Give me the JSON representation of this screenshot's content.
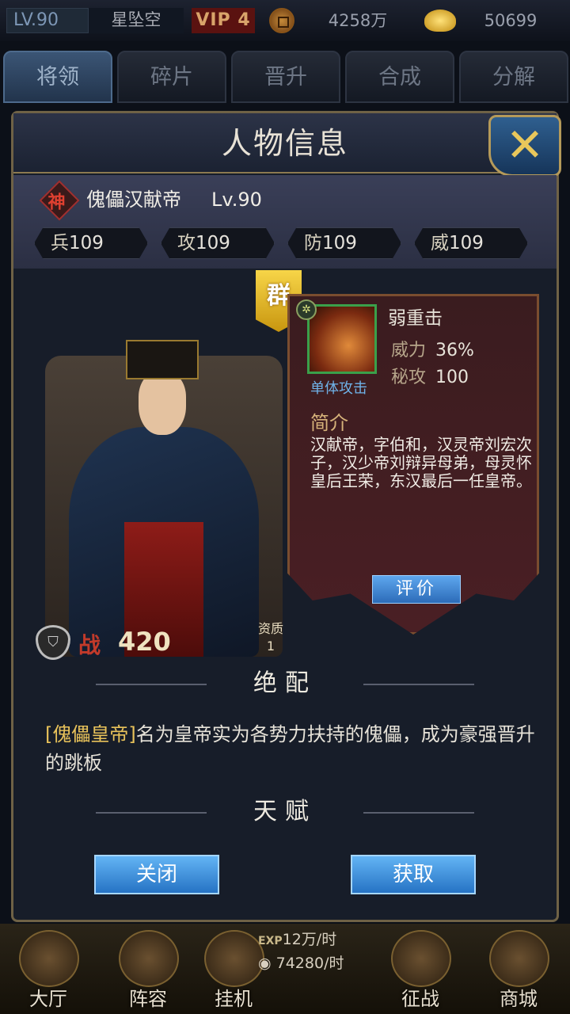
{
  "topbar": {
    "level": "LV.90",
    "player_name": "星坠空",
    "vip": "VIP 4",
    "coins": "4258万",
    "gold": "50699"
  },
  "tabs": [
    {
      "label": "将领",
      "active": true
    },
    {
      "label": "碎片",
      "active": false
    },
    {
      "label": "晋升",
      "active": false
    },
    {
      "label": "合成",
      "active": false
    },
    {
      "label": "分解",
      "active": false
    }
  ],
  "panel": {
    "title": "人物信息",
    "close_glyph": "✕"
  },
  "hero": {
    "rarity": "神",
    "name": "傀儡汉献帝",
    "level": "Lv.90",
    "faction": "群",
    "stats": [
      {
        "label": "兵",
        "value": "109"
      },
      {
        "label": "攻",
        "value": "109"
      },
      {
        "label": "防",
        "value": "109"
      },
      {
        "label": "威",
        "value": "109"
      }
    ],
    "power_label": "战",
    "power": "420",
    "quality_label": "资质",
    "quality": "1"
  },
  "skill": {
    "name": "弱重击",
    "type": "单体攻击",
    "power_label": "威力",
    "power_value": "36%",
    "secret_label": "秘攻",
    "secret_value": "100",
    "intro_title": "简介",
    "intro_text": "汉献帝，字伯和，汉灵帝刘宏次子，汉少帝刘辩异母弟，母灵怀皇后王荣，东汉最后一任皇帝。",
    "rate_label": "评价"
  },
  "match": {
    "title": "绝配",
    "highlight": "[傀儡皇帝]",
    "text": "名为皇帝实为各势力扶持的傀儡，成为豪强晋升的跳板"
  },
  "talent": {
    "title": "天赋"
  },
  "buttons": {
    "close": "关闭",
    "obtain": "获取"
  },
  "bottom_nav": [
    {
      "label": "大厅",
      "icon": "hall-icon"
    },
    {
      "label": "阵容",
      "icon": "lineup-icon"
    },
    {
      "label": "挂机",
      "icon": "hourglass-icon"
    },
    {
      "label": "征战",
      "icon": "swords-icon"
    },
    {
      "label": "商城",
      "icon": "shop-icon"
    }
  ],
  "idle": {
    "exp_tag": "EXP",
    "exp_rate": "12万/时",
    "coin_rate": "74280/时"
  },
  "colors": {
    "gold_border": "#6f6246",
    "button_blue": "#2673c4",
    "highlight": "#e8c25a"
  }
}
